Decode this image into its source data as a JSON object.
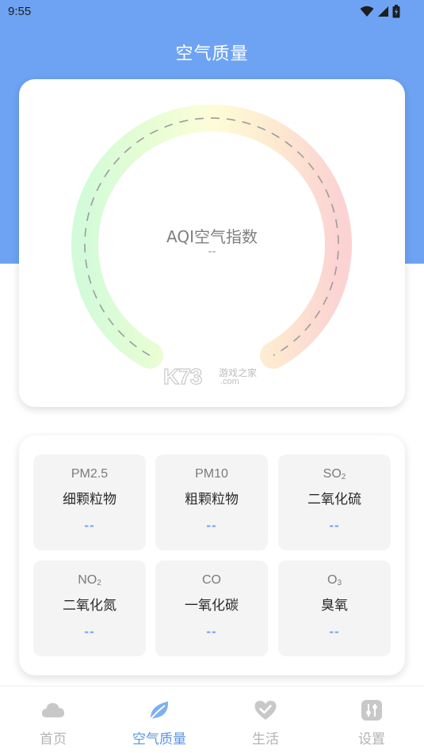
{
  "status_bar": {
    "time": "9:55",
    "icons": [
      "wifi-icon",
      "signal-icon",
      "battery-icon"
    ]
  },
  "header": {
    "title": "空气质量"
  },
  "gauge": {
    "label": "AQI空气指数",
    "value": "--"
  },
  "watermark": {
    "brand": "K73",
    "tagline": "游戏之家",
    "domain": ".com"
  },
  "pollutants": [
    {
      "code": "PM2.5",
      "sub": "",
      "name": "细颗粒物",
      "value": "--"
    },
    {
      "code": "PM10",
      "sub": "",
      "name": "粗颗粒物",
      "value": "--"
    },
    {
      "code": "SO",
      "sub": "2",
      "name": "二氧化硫",
      "value": "--"
    },
    {
      "code": "NO",
      "sub": "2",
      "name": "二氧化氮",
      "value": "--"
    },
    {
      "code": "CO",
      "sub": "",
      "name": "一氧化碳",
      "value": "--"
    },
    {
      "code": "O",
      "sub": "3",
      "name": "臭氧",
      "value": "--"
    }
  ],
  "bottom_nav": {
    "items": [
      {
        "label": "首页",
        "icon": "cloud-icon",
        "active": false
      },
      {
        "label": "空气质量",
        "icon": "leaf-icon",
        "active": true
      },
      {
        "label": "生活",
        "icon": "heart-check-icon",
        "active": false
      },
      {
        "label": "设置",
        "icon": "sliders-icon",
        "active": false
      }
    ]
  },
  "colors": {
    "accent": "#6ea3f3",
    "active_nav": "#5b95e6",
    "inactive_nav": "#b3b3b3",
    "tile_bg": "#f4f4f4"
  }
}
